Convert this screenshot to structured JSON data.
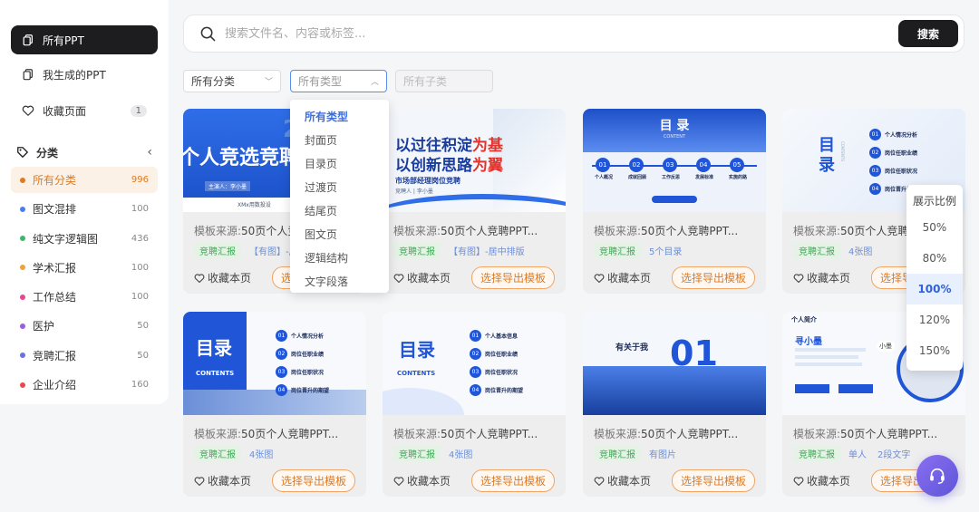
{
  "sidebar": {
    "nav": [
      {
        "label": "所有PPT",
        "active": true
      },
      {
        "label": "我生成的PPT",
        "active": false
      },
      {
        "label": "收藏页面",
        "count": "1",
        "active": false
      }
    ],
    "category_title": "分类",
    "categories": [
      {
        "label": "所有分类",
        "count": "996",
        "color": "#e07a1f",
        "active": true
      },
      {
        "label": "图文混排",
        "count": "100",
        "color": "#4a7cf0"
      },
      {
        "label": "纯文字逻辑图",
        "count": "436",
        "color": "#3fb56b"
      },
      {
        "label": "学术汇报",
        "count": "100",
        "color": "#f0a23a"
      },
      {
        "label": "工作总结",
        "count": "100",
        "color": "#e8458f"
      },
      {
        "label": "医护",
        "count": "50",
        "color": "#9a5ce0"
      },
      {
        "label": "竞聘汇报",
        "count": "50",
        "color": "#6a6fe6"
      },
      {
        "label": "企业介绍",
        "count": "160",
        "color": "#e84a4a"
      }
    ]
  },
  "search": {
    "placeholder": "搜索文件名、内容或标签...",
    "button": "搜索"
  },
  "filters": {
    "category": "所有分类",
    "type": "所有类型",
    "subtype": "所有子类"
  },
  "type_dropdown": [
    "所有类型",
    "封面页",
    "目录页",
    "过渡页",
    "结尾页",
    "图文页",
    "逻辑结构",
    "文字段落"
  ],
  "zoom": {
    "title": "展示比例",
    "options": [
      "50%",
      "80%",
      "100%",
      "120%",
      "150%"
    ],
    "selected": "100%"
  },
  "cards": [
    {
      "source_label": "模板来源:",
      "source": "50页个人竞聘PPT...",
      "tags": [
        "竞聘汇报",
        "【有图】-居中排版"
      ],
      "fav": "收藏本页",
      "export": "选择导出模板",
      "thumb": {
        "title": "个人竞选竞聘",
        "year": "2025",
        "sub": "XMx用数投设",
        "person": "主演人：李小墨"
      }
    },
    {
      "source_label": "模板来源:",
      "source": "50页个人竞聘PPT...",
      "tags": [
        "竞聘汇报",
        "【有图】-居中排版"
      ],
      "fav": "收藏本页",
      "export": "选择导出模板",
      "thumb": {
        "line1a": "以过往积淀",
        "line1b": "为基",
        "line2a": "以创新思路",
        "line2b": "为翼",
        "sub": "市场部经理岗位竞聘",
        "person": "竞聘人 | 李小墨"
      }
    },
    {
      "source_label": "模板来源:",
      "source": "50页个人竞聘PPT...",
      "tags": [
        "竞聘汇报",
        "5个目录"
      ],
      "fav": "收藏本页",
      "export": "选择导出模板",
      "thumb": {
        "title": "目 录",
        "en": "CONTENT",
        "items": [
          "个人概况",
          "成就回顾",
          "工作反思",
          "发展标准",
          "实施的路"
        ]
      }
    },
    {
      "source_label": "模板来源:",
      "source": "50页个人竞聘PPT...",
      "tags": [
        "竞聘汇报",
        "4张图"
      ],
      "fav": "收藏本页",
      "export": "选择导出模板",
      "thumb": {
        "title": "目录",
        "en": "CONTENTS",
        "items": [
          "个人情况分析",
          "岗位任职业绩",
          "岗位任职状况",
          "岗位晋升的期望"
        ]
      }
    },
    {
      "source_label": "模板来源:",
      "source": "50页个人竞聘PPT...",
      "tags": [
        "竞聘汇报",
        "4张图"
      ],
      "fav": "收藏本页",
      "export": "选择导出模板",
      "thumb": {
        "title": "目录",
        "en": "CONTENTS",
        "items": [
          "个人情况分析",
          "岗位任职业绩",
          "岗位任职状况",
          "岗位晋升的期望"
        ]
      }
    },
    {
      "source_label": "模板来源:",
      "source": "50页个人竞聘PPT...",
      "tags": [
        "竞聘汇报",
        "4张图"
      ],
      "fav": "收藏本页",
      "export": "选择导出模板",
      "thumb": {
        "title": "目录",
        "en": "CONTENTS",
        "items": [
          "个人基本信息",
          "岗位任职业绩",
          "岗位任职状况",
          "岗位晋升的期望"
        ]
      }
    },
    {
      "source_label": "模板来源:",
      "source": "50页个人竞聘PPT...",
      "tags": [
        "竞聘汇报",
        "有图片"
      ],
      "fav": "收藏本页",
      "export": "选择导出模板",
      "thumb": {
        "title": "有关于我",
        "num": "01"
      }
    },
    {
      "source_label": "模板来源:",
      "source": "50页个人竞聘PPT...",
      "tags": [
        "竞聘汇报",
        "单人",
        "2段文字"
      ],
      "fav": "收藏本页",
      "export": "选择导出模板",
      "thumb": {
        "title": "个人简介",
        "name": "寻小墨",
        "tag": "小墨"
      }
    }
  ],
  "colors": {
    "accent": "#e07a1f",
    "primary_dark": "#1d1d1f",
    "blue": "#1f55d6"
  }
}
